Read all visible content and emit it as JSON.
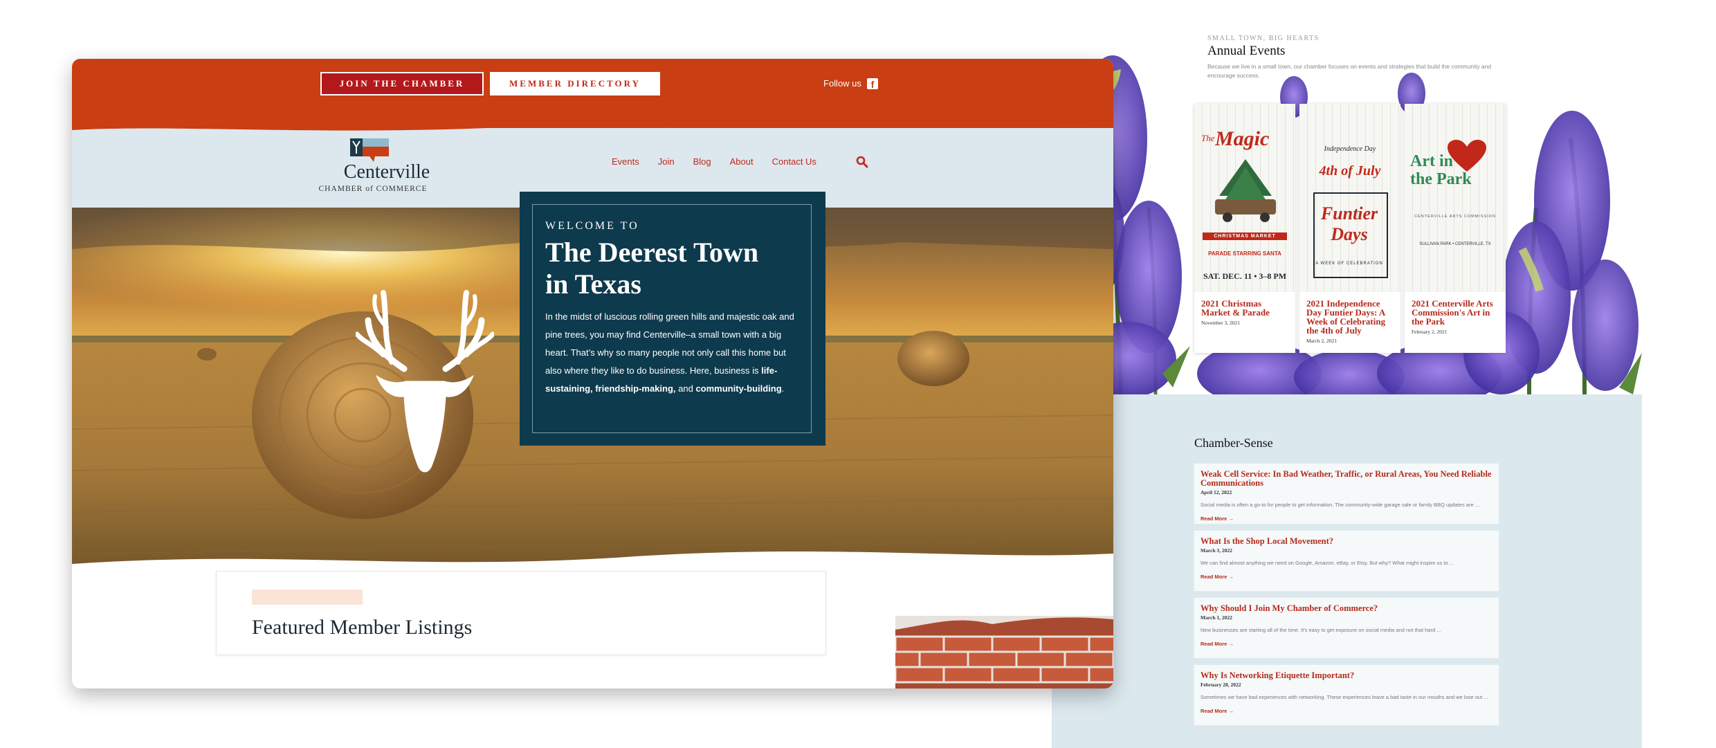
{
  "topbar": {
    "join_button": "JOIN THE CHAMBER",
    "directory_button": "MEMBER DIRECTORY",
    "follow_label": "Follow us",
    "facebook_icon": "facebook-icon",
    "color": "#c93e12"
  },
  "logo": {
    "name": "Centerville",
    "subtitle": "CHAMBER of COMMERCE"
  },
  "nav": {
    "items": [
      "Events",
      "Join",
      "Blog",
      "About",
      "Contact Us"
    ],
    "search_icon": "search-icon"
  },
  "hero": {
    "kicker": "WELCOME TO",
    "title": "The Deerest Town in Texas",
    "body_intro": "In the midst of luscious rolling green hills and majestic oak and pine trees, you may find Centerville–a small town with a big heart. That’s why so many people not only call this home but also where they like to do business. Here, business is ",
    "body_bold_1": "life-sustaining, friendship-making,",
    "body_and": " and ",
    "body_bold_2": "community-building",
    "body_end": "."
  },
  "featured": {
    "title": "Featured Member Listings"
  },
  "events": {
    "kicker": "SMALL TOWN, BIG HEARTS",
    "title": "Annual Events",
    "description": "Because we live in a small town, our chamber focuses on events and strategies that build the community and encourage success.",
    "cards": [
      {
        "name": "2021 Christmas Market & Parade",
        "date": "November 3, 2021",
        "poster_title": "Magic",
        "poster_top": "The",
        "poster_line1": "CHRISTMAS MARKET",
        "poster_line2": "PARADE STARRING SANTA",
        "poster_line3": "SAT. DEC. 11 • 3–8 PM"
      },
      {
        "name": "2021 Independence Day Funtier Days: A Week of Celebrating the 4th of July",
        "date": "March 2, 2021",
        "poster_top": "Independence Day",
        "poster_title": "Funtier Days",
        "poster_line1": "4th of July",
        "poster_line2": "A WEEK OF CELEBRATION"
      },
      {
        "name": "2021 Centerville Arts Commission's Art in the Park",
        "date": "February 2, 2021",
        "poster_title": "Art in the Park",
        "poster_line1": "CENTERVILLE ARTS COMMISSION",
        "poster_line2": "SULLIVAN PARK • CENTERVILLE, TX"
      }
    ]
  },
  "chamber_sense": {
    "title": "Chamber-Sense",
    "posts": [
      {
        "title": "Weak Cell Service: In Bad Weather, Traffic, or Rural Areas, You Need Reliable Communications",
        "date": "April 12, 2022",
        "excerpt": "Social media is often a go-to for people to get information. The community-wide garage sale or family BBQ updates are ...",
        "more": "Read More →"
      },
      {
        "title": "What Is the Shop Local Movement?",
        "date": "March 3, 2022",
        "excerpt": "We can find almost anything we need on Google, Amazon, eBay, or Etsy. But why? What might inspire us to ...",
        "more": "Read More →"
      },
      {
        "title": "Why Should I Join My Chamber of Commerce?",
        "date": "March 1, 2022",
        "excerpt": "New businesses are starting all of the time. It's easy to get exposure on social media and not that hard ...",
        "more": "Read More →"
      },
      {
        "title": "Why Is Networking Etiquette Important?",
        "date": "February 28, 2022",
        "excerpt": "Sometimes we have bad experiences with networking. These experiences leave a bad taste in our mouths and we lose out ...",
        "more": "Read More →"
      }
    ]
  }
}
